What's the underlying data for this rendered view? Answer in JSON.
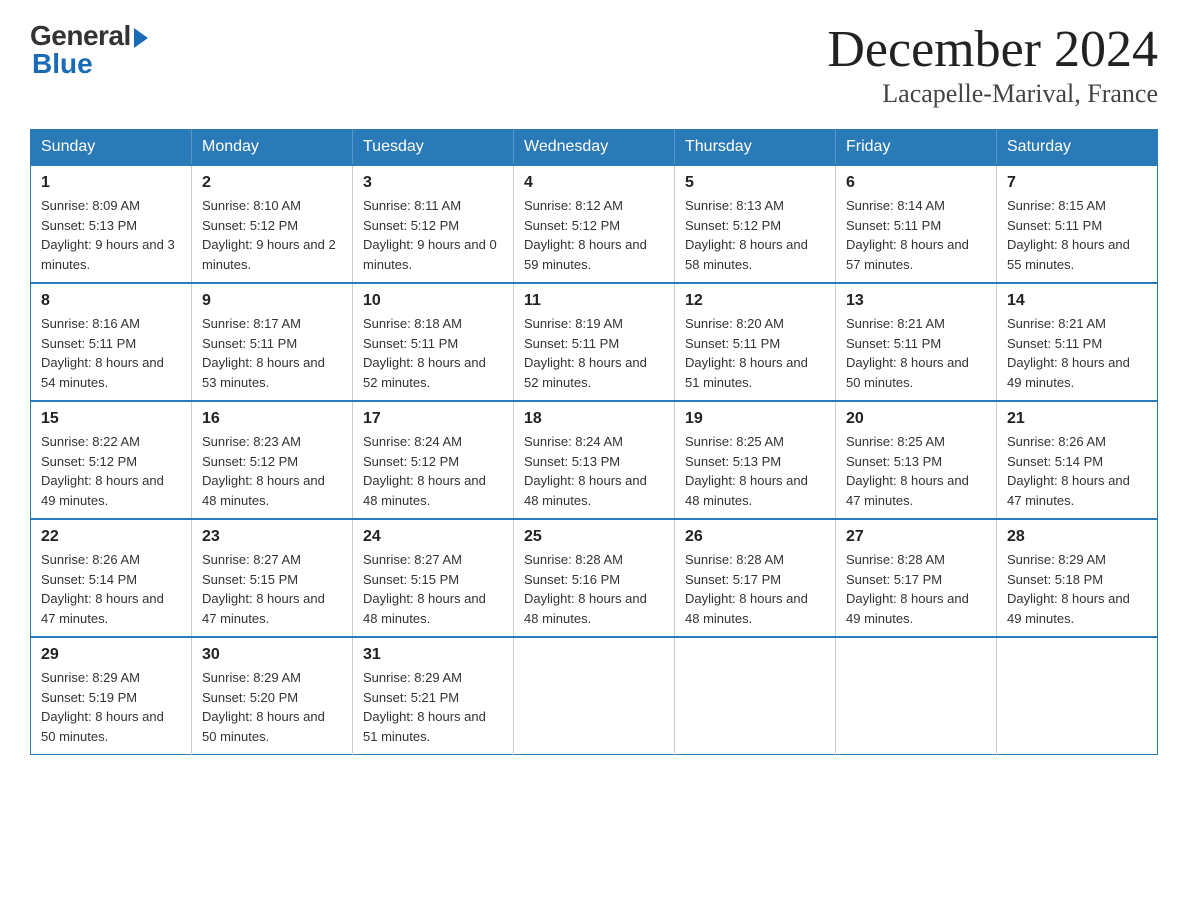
{
  "header": {
    "logo_general": "General",
    "logo_blue": "Blue",
    "month_title": "December 2024",
    "location": "Lacapelle-Marival, France"
  },
  "weekdays": [
    "Sunday",
    "Monday",
    "Tuesday",
    "Wednesday",
    "Thursday",
    "Friday",
    "Saturday"
  ],
  "weeks": [
    [
      {
        "day": "1",
        "sunrise": "8:09 AM",
        "sunset": "5:13 PM",
        "daylight": "9 hours and 3 minutes."
      },
      {
        "day": "2",
        "sunrise": "8:10 AM",
        "sunset": "5:12 PM",
        "daylight": "9 hours and 2 minutes."
      },
      {
        "day": "3",
        "sunrise": "8:11 AM",
        "sunset": "5:12 PM",
        "daylight": "9 hours and 0 minutes."
      },
      {
        "day": "4",
        "sunrise": "8:12 AM",
        "sunset": "5:12 PM",
        "daylight": "8 hours and 59 minutes."
      },
      {
        "day": "5",
        "sunrise": "8:13 AM",
        "sunset": "5:12 PM",
        "daylight": "8 hours and 58 minutes."
      },
      {
        "day": "6",
        "sunrise": "8:14 AM",
        "sunset": "5:11 PM",
        "daylight": "8 hours and 57 minutes."
      },
      {
        "day": "7",
        "sunrise": "8:15 AM",
        "sunset": "5:11 PM",
        "daylight": "8 hours and 55 minutes."
      }
    ],
    [
      {
        "day": "8",
        "sunrise": "8:16 AM",
        "sunset": "5:11 PM",
        "daylight": "8 hours and 54 minutes."
      },
      {
        "day": "9",
        "sunrise": "8:17 AM",
        "sunset": "5:11 PM",
        "daylight": "8 hours and 53 minutes."
      },
      {
        "day": "10",
        "sunrise": "8:18 AM",
        "sunset": "5:11 PM",
        "daylight": "8 hours and 52 minutes."
      },
      {
        "day": "11",
        "sunrise": "8:19 AM",
        "sunset": "5:11 PM",
        "daylight": "8 hours and 52 minutes."
      },
      {
        "day": "12",
        "sunrise": "8:20 AM",
        "sunset": "5:11 PM",
        "daylight": "8 hours and 51 minutes."
      },
      {
        "day": "13",
        "sunrise": "8:21 AM",
        "sunset": "5:11 PM",
        "daylight": "8 hours and 50 minutes."
      },
      {
        "day": "14",
        "sunrise": "8:21 AM",
        "sunset": "5:11 PM",
        "daylight": "8 hours and 49 minutes."
      }
    ],
    [
      {
        "day": "15",
        "sunrise": "8:22 AM",
        "sunset": "5:12 PM",
        "daylight": "8 hours and 49 minutes."
      },
      {
        "day": "16",
        "sunrise": "8:23 AM",
        "sunset": "5:12 PM",
        "daylight": "8 hours and 48 minutes."
      },
      {
        "day": "17",
        "sunrise": "8:24 AM",
        "sunset": "5:12 PM",
        "daylight": "8 hours and 48 minutes."
      },
      {
        "day": "18",
        "sunrise": "8:24 AM",
        "sunset": "5:13 PM",
        "daylight": "8 hours and 48 minutes."
      },
      {
        "day": "19",
        "sunrise": "8:25 AM",
        "sunset": "5:13 PM",
        "daylight": "8 hours and 48 minutes."
      },
      {
        "day": "20",
        "sunrise": "8:25 AM",
        "sunset": "5:13 PM",
        "daylight": "8 hours and 47 minutes."
      },
      {
        "day": "21",
        "sunrise": "8:26 AM",
        "sunset": "5:14 PM",
        "daylight": "8 hours and 47 minutes."
      }
    ],
    [
      {
        "day": "22",
        "sunrise": "8:26 AM",
        "sunset": "5:14 PM",
        "daylight": "8 hours and 47 minutes."
      },
      {
        "day": "23",
        "sunrise": "8:27 AM",
        "sunset": "5:15 PM",
        "daylight": "8 hours and 47 minutes."
      },
      {
        "day": "24",
        "sunrise": "8:27 AM",
        "sunset": "5:15 PM",
        "daylight": "8 hours and 48 minutes."
      },
      {
        "day": "25",
        "sunrise": "8:28 AM",
        "sunset": "5:16 PM",
        "daylight": "8 hours and 48 minutes."
      },
      {
        "day": "26",
        "sunrise": "8:28 AM",
        "sunset": "5:17 PM",
        "daylight": "8 hours and 48 minutes."
      },
      {
        "day": "27",
        "sunrise": "8:28 AM",
        "sunset": "5:17 PM",
        "daylight": "8 hours and 49 minutes."
      },
      {
        "day": "28",
        "sunrise": "8:29 AM",
        "sunset": "5:18 PM",
        "daylight": "8 hours and 49 minutes."
      }
    ],
    [
      {
        "day": "29",
        "sunrise": "8:29 AM",
        "sunset": "5:19 PM",
        "daylight": "8 hours and 50 minutes."
      },
      {
        "day": "30",
        "sunrise": "8:29 AM",
        "sunset": "5:20 PM",
        "daylight": "8 hours and 50 minutes."
      },
      {
        "day": "31",
        "sunrise": "8:29 AM",
        "sunset": "5:21 PM",
        "daylight": "8 hours and 51 minutes."
      },
      null,
      null,
      null,
      null
    ]
  ],
  "labels": {
    "sunrise": "Sunrise:",
    "sunset": "Sunset:",
    "daylight": "Daylight:"
  }
}
